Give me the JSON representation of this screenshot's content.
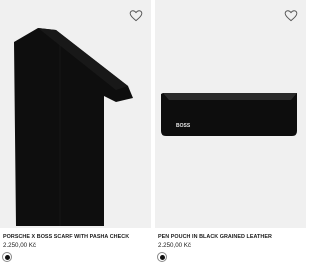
{
  "products": [
    {
      "name": "PORSCHE X BOSS SCARF WITH PASHA CHECK",
      "price": "2.250,00 Kč",
      "wishlist_icon": "heart-outline-icon",
      "swatch_color": "#111111"
    },
    {
      "name": "PEN POUCH IN BLACK GRAINED LEATHER",
      "price": "2.250,00 Kč",
      "wishlist_icon": "heart-outline-icon",
      "swatch_color": "#111111",
      "logo_text": "BOSS"
    }
  ]
}
